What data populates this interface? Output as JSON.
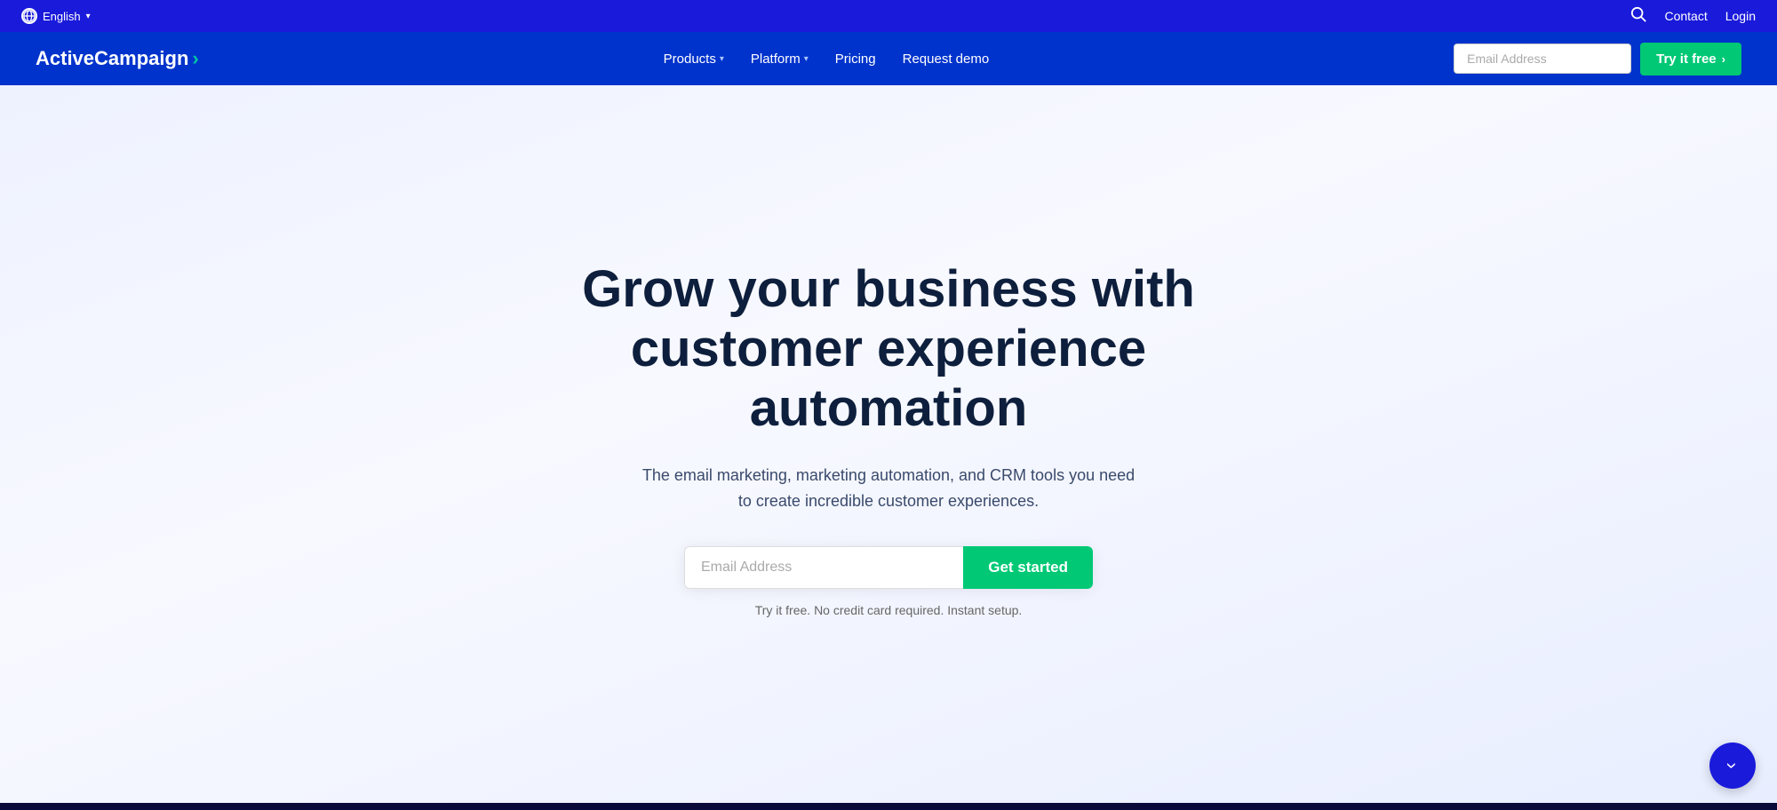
{
  "topbar": {
    "language": "English",
    "chevron": "▾",
    "contact": "Contact",
    "login": "Login",
    "search_label": "search"
  },
  "nav": {
    "logo": "ActiveCampaign",
    "logo_arrow": "›",
    "products_label": "Products",
    "platform_label": "Platform",
    "pricing_label": "Pricing",
    "request_demo_label": "Request demo",
    "email_placeholder": "Email Address",
    "try_free_label": "Try it free",
    "try_free_arrow": "›"
  },
  "hero": {
    "title": "Grow your business with customer experience automation",
    "subtitle": "The email marketing, marketing automation, and CRM tools you need to create incredible customer experiences.",
    "email_placeholder": "Email Address",
    "get_started_label": "Get started",
    "note": "Try it free. No credit card required. Instant setup."
  },
  "scroll": {
    "arrow": "›"
  }
}
